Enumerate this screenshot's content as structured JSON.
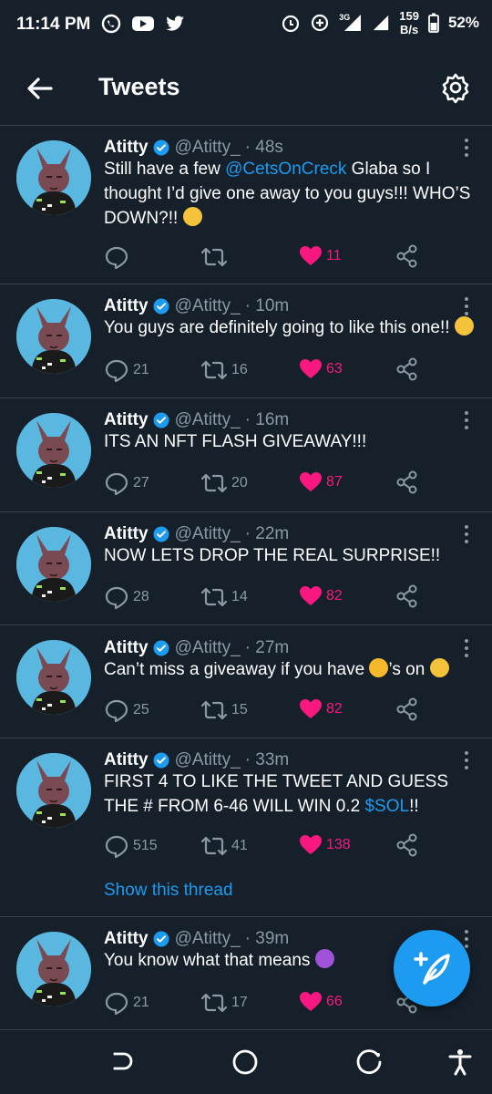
{
  "status_bar": {
    "time": "11:14 PM",
    "network_type": "3G",
    "speed_value": "159",
    "speed_unit": "B/s",
    "battery": "52%"
  },
  "app_bar": {
    "title": "Tweets"
  },
  "author": {
    "name": "Atitty",
    "handle": "@Atitty_"
  },
  "tweets": [
    {
      "time": "· 48s",
      "text_before": "Still have a few ",
      "mention": "@CetsOnCreck",
      "text_after": " Glaba so I thought I’d give one away to you guys!!! WHO’S DOWN?!! ",
      "emoji": "sunglasses",
      "replies": "",
      "retweets": "",
      "likes": "11"
    },
    {
      "time": "· 10m",
      "text": "You guys are definitely going to like this one!! ",
      "emoji": "party",
      "replies": "21",
      "retweets": "16",
      "likes": "63"
    },
    {
      "time": "· 16m",
      "text": "ITS AN NFT FLASH GIVEAWAY!!!",
      "replies": "27",
      "retweets": "20",
      "likes": "87"
    },
    {
      "time": "· 22m",
      "text": "NOW LETS DROP THE REAL SURPRISE!!",
      "replies": "28",
      "retweets": "14",
      "likes": "82"
    },
    {
      "time": "· 27m",
      "text_before": "Can’t miss a giveaway if you have ",
      "text_after": "’s on ",
      "emoji_mid": "bell",
      "emoji": "relieved",
      "replies": "25",
      "retweets": "15",
      "likes": "82"
    },
    {
      "time": "· 33m",
      "text_before": "FIRST 4 TO LIKE THE TWEET AND GUESS THE # FROM 6-46 WILL WIN 0.2 ",
      "cashtag": "$SOL",
      "text_after": "!!",
      "replies": "515",
      "retweets": "41",
      "likes": "138",
      "show_thread": "Show this thread"
    },
    {
      "time": "· 39m",
      "text": "You know what that means ",
      "emoji": "devil",
      "replies": "21",
      "retweets": "17",
      "likes": "66"
    }
  ],
  "colors": {
    "background": "#15202b",
    "accent": "#1d9bf0",
    "like": "#f91880",
    "muted": "#8b98a5"
  }
}
